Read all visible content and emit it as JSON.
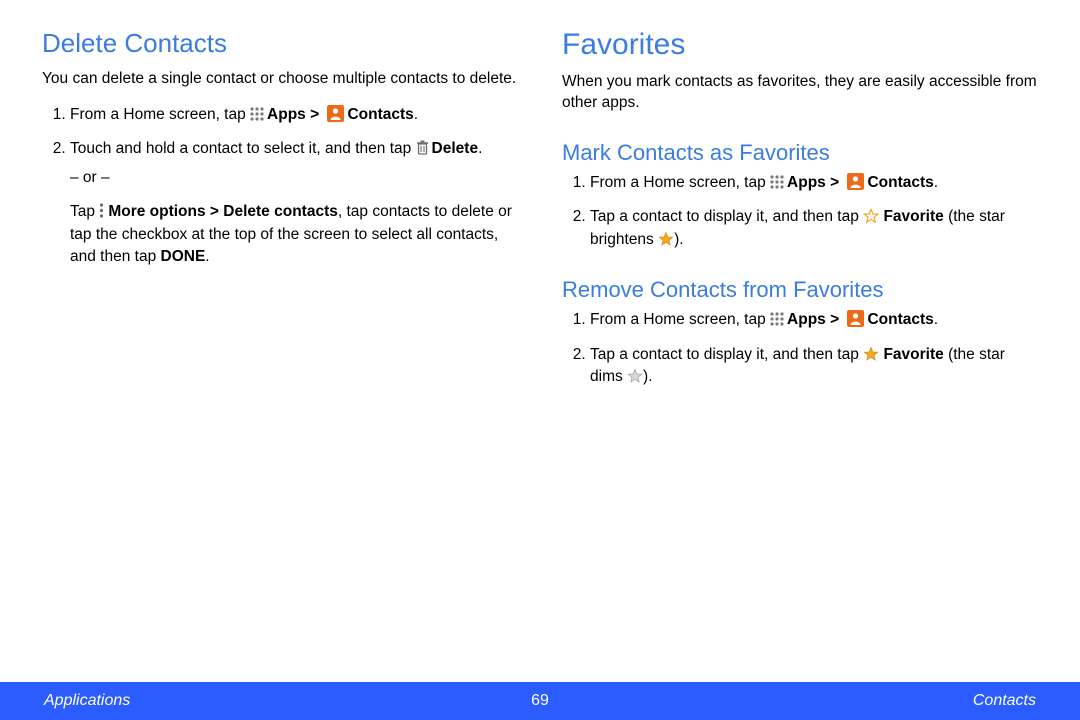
{
  "left": {
    "heading": "Delete Contacts",
    "intro": "You can delete a single contact or choose multiple contacts to delete.",
    "step1_a": "From a Home screen, tap ",
    "apps": "Apps",
    "gt": " > ",
    "contacts": "Contacts",
    "period": ".",
    "step2_a": "Touch and hold a contact to select it, and then tap ",
    "delete": "Delete",
    "or": "– or –",
    "alt_a": "Tap ",
    "more_opts": "More options > Delete contacts",
    "alt_b": ", tap contacts to delete or tap the checkbox at the top of the screen to select all contacts, and then tap ",
    "done": "DONE"
  },
  "right": {
    "heading": "Favorites",
    "intro": "When you mark contacts as favorites, they are easily accessible from other apps.",
    "sub1": "Mark Contacts as Favorites",
    "m_step1_a": "From a Home screen, tap ",
    "m_step2_a": "Tap a contact to display it, and then tap ",
    "favorite": "Favorite",
    "m_step2_b": " (the star brightens ",
    "close": ").",
    "sub2": "Remove Contacts from Favorites",
    "r_step2_b": " (the star dims "
  },
  "footer": {
    "left": "Applications",
    "center": "69",
    "right": "Contacts"
  },
  "icons": {
    "apps": "apps-icon",
    "contacts": "contacts-icon",
    "trash": "trash-icon",
    "more": "more-options-icon",
    "star_outline": "star-outline-icon",
    "star_gold": "star-filled-gold-icon",
    "star_dim": "star-dim-icon"
  }
}
